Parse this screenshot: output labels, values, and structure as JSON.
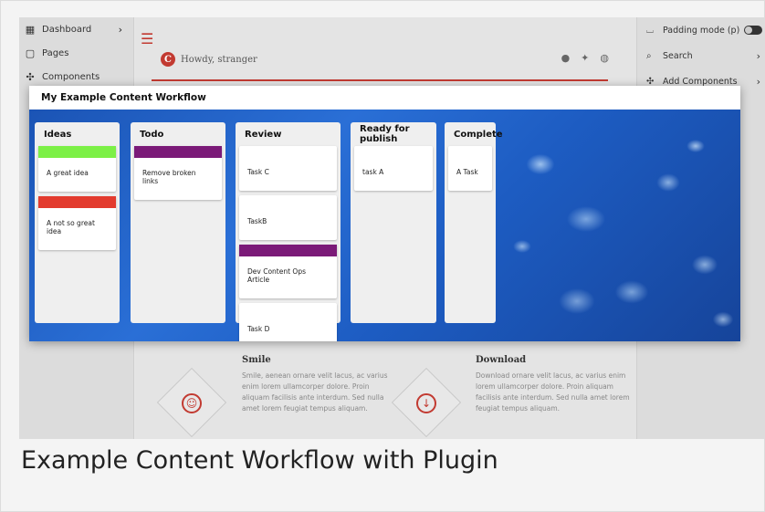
{
  "caption": "Example Content Workflow with Plugin",
  "left_sidebar": {
    "items": [
      {
        "label": "Dashboard",
        "icon": "grid-icon",
        "chevron": true
      },
      {
        "label": "Pages",
        "icon": "document-icon",
        "chevron": false
      },
      {
        "label": "Components",
        "icon": "puzzle-icon",
        "chevron": false
      }
    ]
  },
  "right_sidebar": {
    "items": [
      {
        "label": "Padding mode (p)",
        "icon": "padding-icon",
        "toggle": true
      },
      {
        "label": "Search",
        "icon": "search-icon",
        "chevron": true
      },
      {
        "label": "Add Components",
        "icon": "puzzle-icon",
        "chevron": true
      }
    ]
  },
  "header": {
    "greeting": "Howdy, stranger",
    "logo_letter": "C",
    "menu_icon": "hamburger-icon",
    "social_icons": [
      "github-icon",
      "twitter-icon",
      "github-cat-icon"
    ]
  },
  "features": [
    {
      "title": "Smile",
      "text": "Smile, aenean ornare velit lacus, ac varius enim lorem ullamcorper dolore. Proin aliquam facilisis ante interdum. Sed nulla amet lorem feugiat tempus aliquam.",
      "icon": "smile-icon"
    },
    {
      "title": "Download",
      "text": "Download ornare velit lacus, ac varius enim lorem ullamcorper dolore. Proin aliquam facilisis ante interdum. Sed nulla amet lorem feugiat tempus aliquam.",
      "icon": "download-icon"
    }
  ],
  "modal": {
    "title": "My Example Content Workflow",
    "columns": [
      {
        "title": "Ideas",
        "tasks": [
          {
            "label": "A great idea",
            "color": "#7cf046"
          },
          {
            "label": "A not so great idea",
            "color": "#e33b2e"
          }
        ]
      },
      {
        "title": "Todo",
        "tasks": [
          {
            "label": "Remove broken links",
            "color": "#7b1a78"
          }
        ]
      },
      {
        "title": "Review",
        "tasks": [
          {
            "label": "Task C",
            "color": ""
          },
          {
            "label": "TaskB",
            "color": ""
          },
          {
            "label": "Dev Content Ops Article",
            "color": "#7b1a78"
          },
          {
            "label": "Task D",
            "color": ""
          }
        ]
      },
      {
        "title": "Ready for publish",
        "tasks": [
          {
            "label": "task A",
            "color": ""
          }
        ]
      },
      {
        "title": "Complete",
        "tasks": [
          {
            "label": "A Task",
            "color": ""
          }
        ]
      }
    ]
  }
}
